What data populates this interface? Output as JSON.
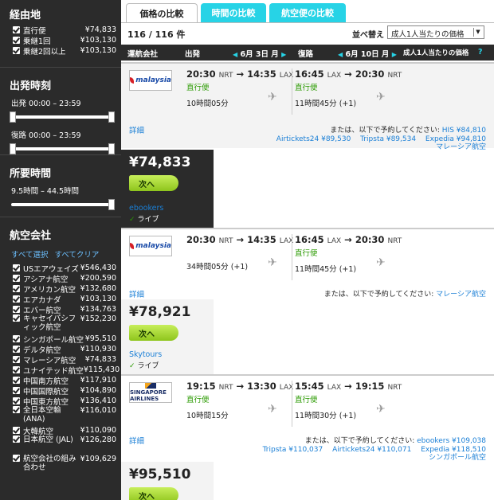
{
  "sidebar": {
    "stops": {
      "title": "経由地",
      "items": [
        {
          "label": "直行便",
          "price": "¥74,833"
        },
        {
          "label": "乗継1回",
          "price": "¥103,130"
        },
        {
          "label": "乗継2回以上",
          "price": "¥103,130"
        }
      ]
    },
    "departure": {
      "title": "出発時刻",
      "outbound": "出発 00:00 – 23:59",
      "return": "復路 00:00 – 23:59"
    },
    "duration": {
      "title": "所要時間",
      "range": "9.5時間 – 44.5時間"
    },
    "airlines": {
      "title": "航空会社",
      "select_all": "すべて選択",
      "clear_all": "すべてクリア",
      "items": [
        {
          "label": "USエアウェイズ",
          "price": "¥546,430"
        },
        {
          "label": "アシアナ航空",
          "price": "¥200,590"
        },
        {
          "label": "アメリカン航空",
          "price": "¥132,680"
        },
        {
          "label": "エアカナダ",
          "price": "¥103,130"
        },
        {
          "label": "エバー航空",
          "price": "¥134,763"
        },
        {
          "label": "キャセイパシフィック航空",
          "price": "¥152,230"
        },
        {
          "label": "シンガポール航空",
          "price": "¥95,510"
        },
        {
          "label": "デルタ航空",
          "price": "¥110,930"
        },
        {
          "label": "マレーシア航空",
          "price": "¥74,833"
        },
        {
          "label": "ユナイテッド航空",
          "price": "¥115,430"
        },
        {
          "label": "中国南方航空",
          "price": "¥117,910"
        },
        {
          "label": "中国国際航空",
          "price": "¥104,890"
        },
        {
          "label": "中国東方航空",
          "price": "¥136,410"
        },
        {
          "label": "全日本空輸 (ANA)",
          "price": "¥116,010"
        },
        {
          "label": "大韓航空",
          "price": "¥110,090"
        },
        {
          "label": "日本航空 (JAL)",
          "price": "¥126,280"
        },
        {
          "label": "航空会社の組み合わせ",
          "price": "¥109,629"
        }
      ]
    }
  },
  "tabs": [
    {
      "label": "価格の比較"
    },
    {
      "label": "時間の比較"
    },
    {
      "label": "航空便の比較"
    }
  ],
  "results_count": "116 / 116 件",
  "sort": {
    "label": "並べ替え",
    "value": "成人1人当たりの価格"
  },
  "header": {
    "airline": "運航会社",
    "outbound": "出発",
    "outbound_date": "6月 3日 月",
    "return": "復路",
    "return_date": "6月 10日 月",
    "price_per_adult": "成人1人当たりの価格",
    "help": "?"
  },
  "results": [
    {
      "logo": "malaysia",
      "out_dep": "20:30",
      "out_dep_ap": "NRT",
      "out_arr": "14:35",
      "out_arr_ap": "LAX",
      "out_type": "直行便",
      "out_dur": "10時間05分",
      "ret_dep": "16:45",
      "ret_dep_ap": "LAX",
      "ret_arr": "20:30",
      "ret_arr_ap": "NRT",
      "ret_type": "直行便",
      "ret_dur": "11時間45分 (+1)",
      "detail": "詳細",
      "others_title": "または、以下で予約してください:",
      "others_line1": "HIS ¥84,810",
      "others_line2": "Airtickets24 ¥89,530　 Tripsta ¥89,534　 Expedia ¥94,810",
      "others_line3": "マレーシア航空",
      "price": "¥74,833",
      "go": "次へ",
      "agent": "ebookers",
      "live": "ライブ"
    },
    {
      "logo": "malaysia",
      "out_dep": "20:30",
      "out_dep_ap": "NRT",
      "out_arr": "14:35",
      "out_arr_ap": "LAX",
      "out_type": "",
      "out_dur": "34時間05分 (+1)",
      "ret_dep": "16:45",
      "ret_dep_ap": "LAX",
      "ret_arr": "20:30",
      "ret_arr_ap": "NRT",
      "ret_type": "直行便",
      "ret_dur": "11時間45分 (+1)",
      "detail": "詳細",
      "others_title": "または、以下で予約してください:",
      "others_line1": "マレーシア航空",
      "price": "¥78,921",
      "go": "次へ",
      "agent": "Skytours",
      "live": "ライブ"
    },
    {
      "logo": "singapore",
      "logo_text": "SINGAPORE AIRLINES",
      "out_dep": "19:15",
      "out_dep_ap": "NRT",
      "out_arr": "13:30",
      "out_arr_ap": "LAX",
      "out_type": "直行便",
      "out_dur": "10時間15分",
      "ret_dep": "15:45",
      "ret_dep_ap": "LAX",
      "ret_arr": "19:15",
      "ret_arr_ap": "NRT",
      "ret_type": "直行便",
      "ret_dur": "11時間30分 (+1)",
      "detail": "詳細",
      "others_title": "または、以下で予約してください:",
      "others_line1": "ebookers ¥109,038",
      "others_line2": "Tripsta ¥110,037　 Airtickets24 ¥110,071　 Expedia ¥118,510",
      "others_line3": "シンガポール航空",
      "price": "¥95,510",
      "go": "次へ"
    }
  ],
  "colors": {
    "sidebar_bg": "#2b2b2b",
    "tab_active_bg": "#ffffff",
    "tab_inactive_bg": "#27d3e6",
    "direct_green": "#2a9a00",
    "link_blue": "#1a7fd6",
    "go_button": "#a6d92e"
  }
}
